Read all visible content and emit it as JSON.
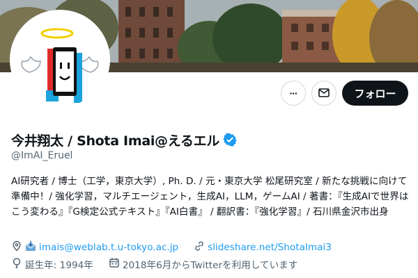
{
  "header": {
    "more_label": "···",
    "follow_label": "フォロー"
  },
  "profile": {
    "display_name": "今井翔太 / Shota Imai@えるエル",
    "handle": "@ImAI_Eruel",
    "verified": true,
    "bio": "AI研究者 / 博士（工学，東京大学）, Ph. D. /  元・東京大学 松尾研究室 / 新たな挑戦に向けて準備中！/ 強化学習，マルチエージェント，生成AI，LLM，ゲームAI / 著書：『生成AIで世界はこう変わる』『G検定公式テキスト』『AI白書』 / 翻訳書：『強化学習』/ 石川県金沢市出身",
    "location": "imais@weblab.t.u-tokyo.ac.jp",
    "website": "slideshare.net/ShotaImai3",
    "birthday": "誕生年: 1994年",
    "joined": "2018年6月からTwitterを利用しています"
  },
  "colors": {
    "accent": "#1d9bf0",
    "text": "#0f1419",
    "muted": "#536471",
    "follow_bg": "#0f1419"
  },
  "icons": [
    "more-icon",
    "mail-icon",
    "verified-icon",
    "location-icon",
    "link-icon",
    "birthday-icon",
    "calendar-icon"
  ]
}
